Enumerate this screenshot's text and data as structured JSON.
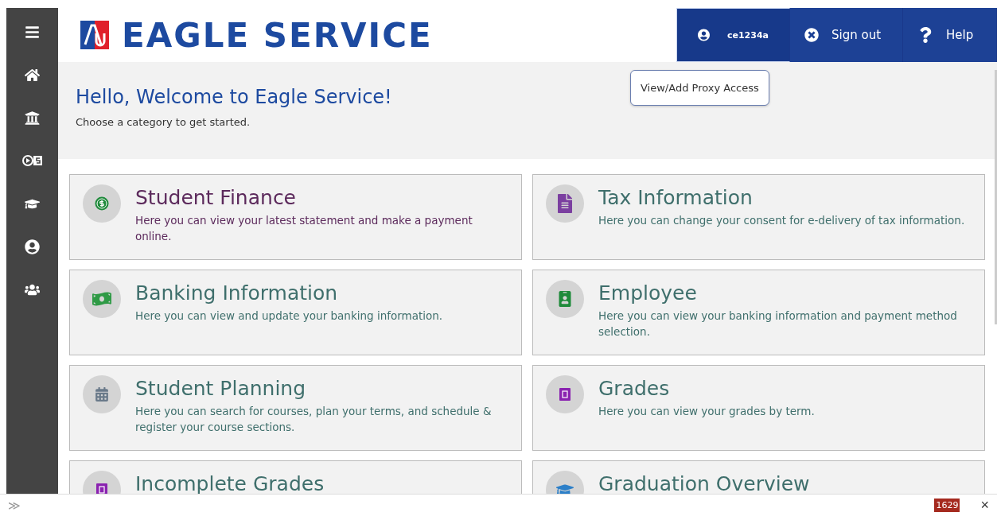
{
  "brand": {
    "title": "EAGLE SERVICE"
  },
  "sidebar": {
    "items": [
      {
        "kind": "menu"
      },
      {
        "kind": "home"
      },
      {
        "kind": "bank"
      },
      {
        "kind": "toggle"
      },
      {
        "kind": "cap"
      },
      {
        "kind": "user"
      },
      {
        "kind": "group"
      }
    ]
  },
  "header_actions": [
    {
      "kind": "user",
      "label": "ce1234a",
      "selected": true
    },
    {
      "kind": "signout",
      "label": "Sign out",
      "selected": false
    },
    {
      "kind": "help",
      "label": "Help",
      "selected": false
    }
  ],
  "tooltip": "View/Add Proxy Access",
  "welcome": {
    "title": "Hello, Welcome to Eagle Service!",
    "subtitle": "Choose a category to get started."
  },
  "categories": [
    {
      "kind": "finance",
      "title": "Student Finance",
      "description": "Here you can view your latest statement and make a payment online.",
      "selected": true
    },
    {
      "kind": "tax",
      "title": "Tax Information",
      "description": "Here you can change your consent for e-delivery of tax information.",
      "selected": false
    },
    {
      "kind": "banking",
      "title": "Banking Information",
      "description": "Here you can view and update your banking information.",
      "selected": false
    },
    {
      "kind": "employee",
      "title": "Employee",
      "description": "Here you can view your banking information and payment method selection.",
      "selected": false
    },
    {
      "kind": "planning",
      "title": "Student Planning",
      "description": "Here you can search for courses, plan your terms, and schedule & register your course sections.",
      "selected": false
    },
    {
      "kind": "grades",
      "title": "Grades",
      "description": "Here you can view your grades by term.",
      "selected": false
    },
    {
      "kind": "grades",
      "title": "Incomplete Grades",
      "selected": false
    },
    {
      "kind": "graduation",
      "title": "Graduation Overview",
      "selected": false
    }
  ],
  "bottom_bar": {
    "expand": "≫",
    "badge": "1629",
    "close": "×"
  }
}
